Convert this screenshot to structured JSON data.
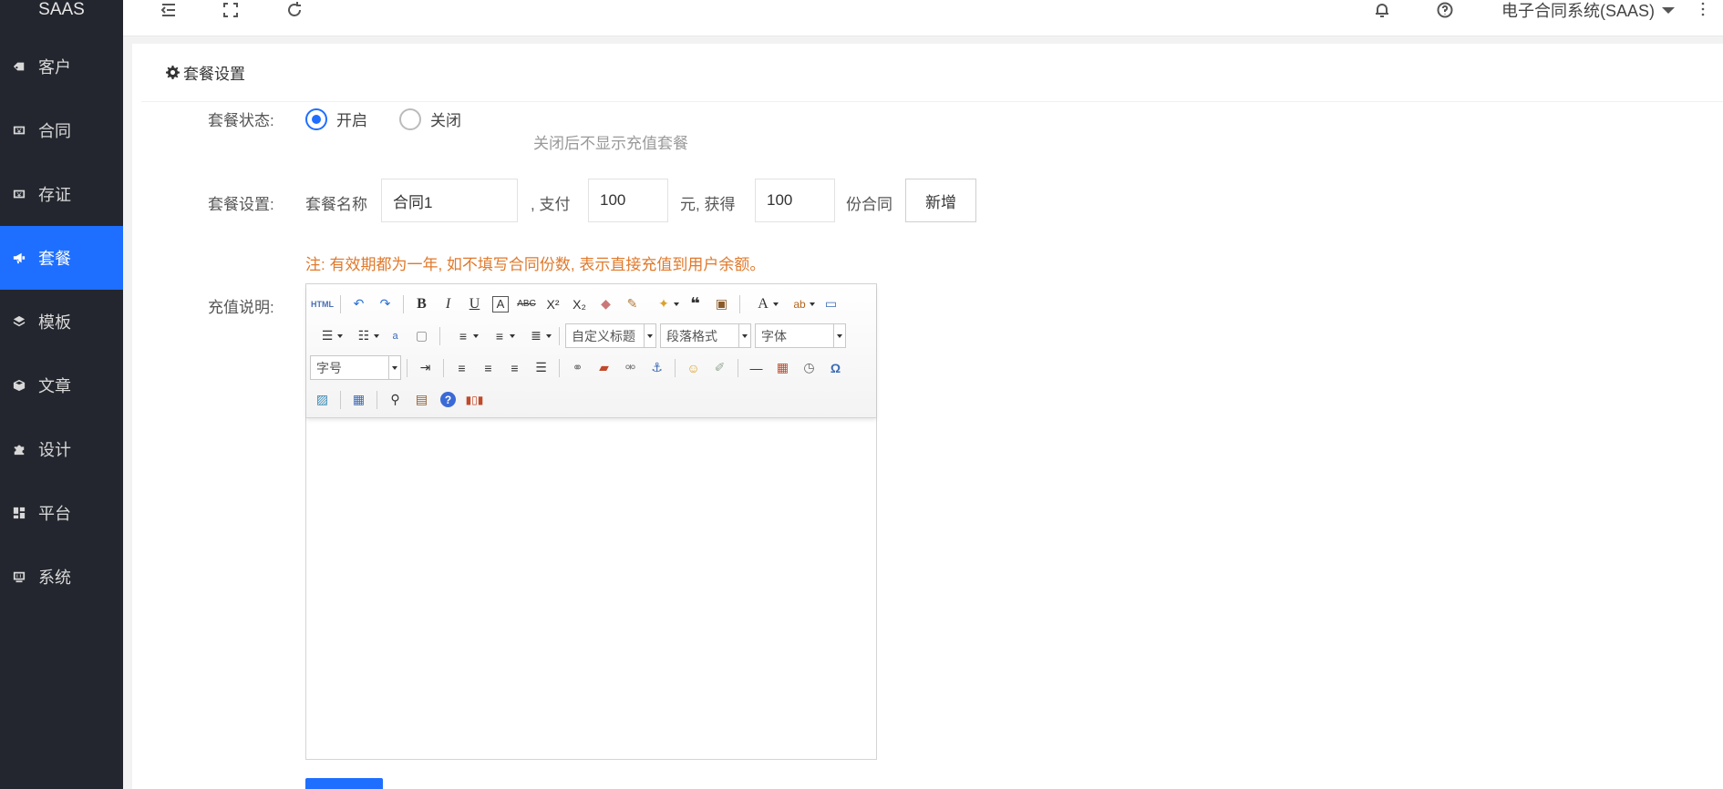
{
  "app": {
    "logo": "SAAS"
  },
  "sidebar": {
    "items": [
      {
        "label": "客户",
        "icon": "tag-icon"
      },
      {
        "label": "合同",
        "icon": "yen-icon"
      },
      {
        "label": "存证",
        "icon": "yen-icon"
      },
      {
        "label": "套餐",
        "icon": "megaphone-icon",
        "active": true
      },
      {
        "label": "模板",
        "icon": "layers-icon"
      },
      {
        "label": "文章",
        "icon": "cube-icon"
      },
      {
        "label": "设计",
        "icon": "puzzle-icon"
      },
      {
        "label": "平台",
        "icon": "dashboard-icon"
      },
      {
        "label": "系统",
        "icon": "settings-icon"
      }
    ]
  },
  "header": {
    "system_name": "电子合同系统(SAAS)"
  },
  "page": {
    "title": "套餐设置",
    "status_label": "套餐状态:",
    "status_on": "开启",
    "status_off": "关闭",
    "status_hint": "关闭后不显示充值套餐",
    "setting_label": "套餐设置:",
    "name_label": "套餐名称",
    "name_value": "合同1",
    "pay_label": ", 支付",
    "pay_value": "100",
    "unit_label": "元, 获得",
    "count_value": "100",
    "count_unit": "份合同",
    "add_button": "新增",
    "note": "注: 有效期都为一年, 如不填写合同份数, 表示直接充值到用户余额。",
    "desc_label": "充值说明:"
  },
  "editor": {
    "html_label": "HTML",
    "combo_heading": "自定义标题",
    "combo_paragraph": "段落格式",
    "combo_font": "字体",
    "combo_size": "字号"
  },
  "colors": {
    "accent": "#1e6fff",
    "note": "#e0792b",
    "sidebar": "#23262e"
  }
}
